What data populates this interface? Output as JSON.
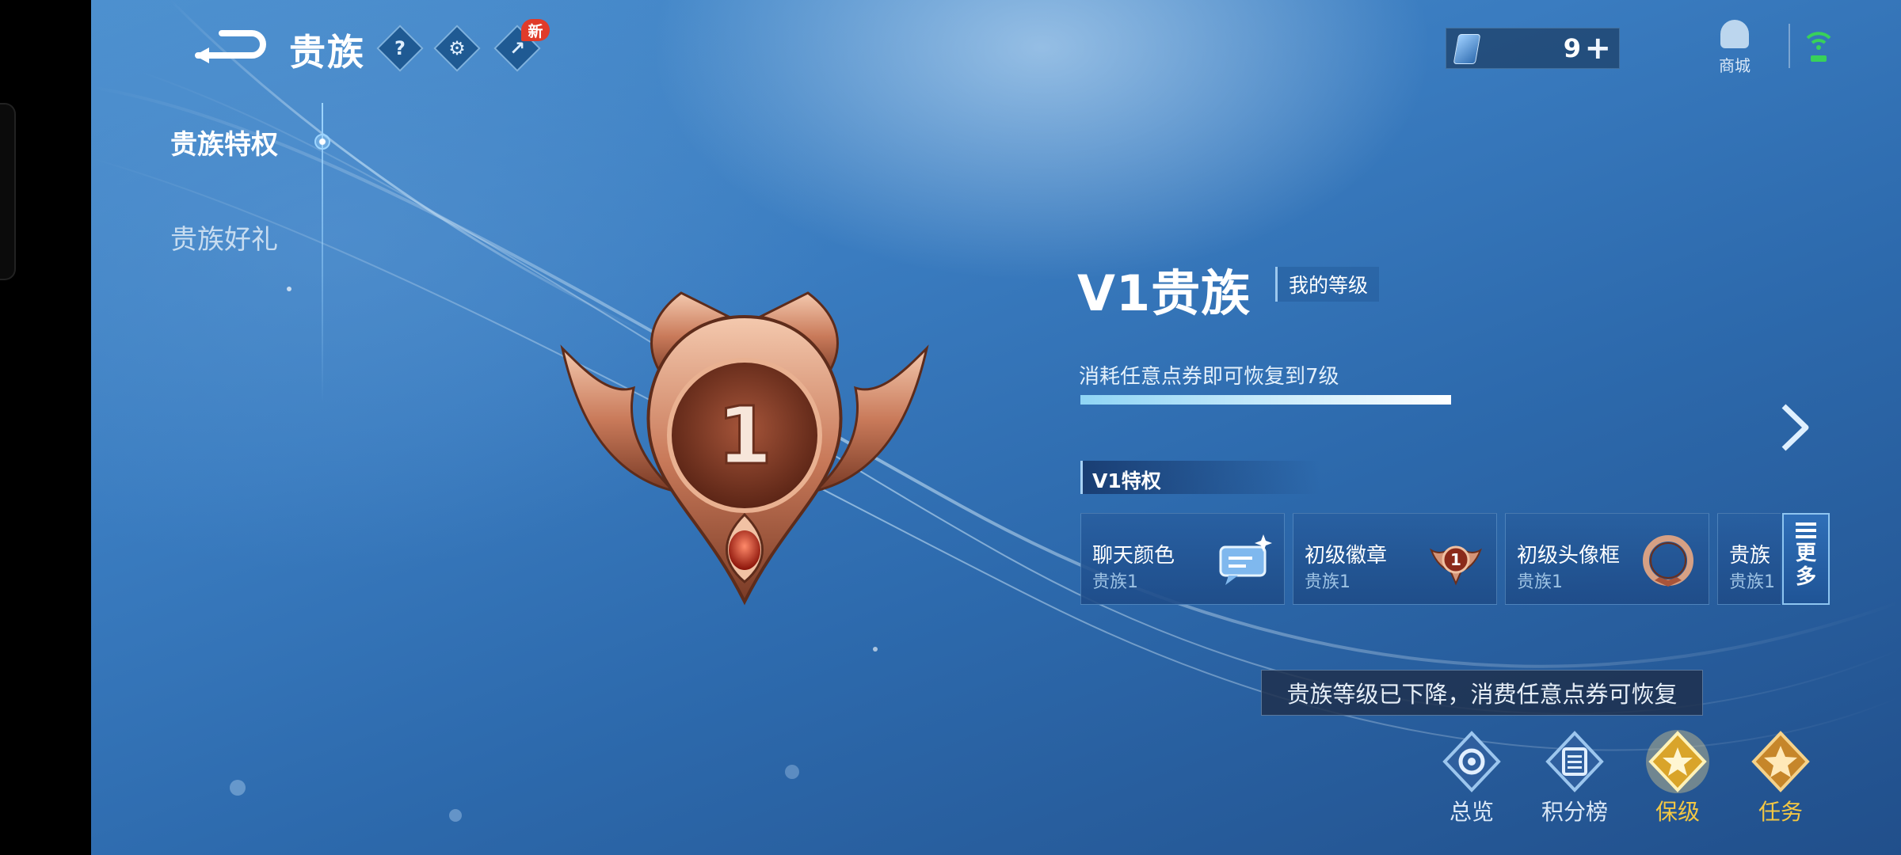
{
  "header": {
    "title": "贵族",
    "help_icon_glyph": "?",
    "new_badge": "新",
    "tickets": {
      "count": "9",
      "plus": "+"
    },
    "shop_label": "商城"
  },
  "sidebar": {
    "items": [
      {
        "label": "贵族特权",
        "active": true
      },
      {
        "label": "贵族好礼",
        "active": false
      }
    ]
  },
  "emblem": {
    "level": "1"
  },
  "panel": {
    "vip_title": "V1贵族",
    "my_level_label": "我的等级",
    "restore_hint": "消耗任意点券即可恢复到7级",
    "progress_fraction": 1.0,
    "privileges_header": "V1特权",
    "privileges": [
      {
        "title": "聊天颜色",
        "sub": "贵族1",
        "icon": "chat-bubble-icon"
      },
      {
        "title": "初级徽章",
        "sub": "贵族1",
        "icon": "badge-icon"
      },
      {
        "title": "初级头像框",
        "sub": "贵族1",
        "icon": "avatar-frame-icon"
      },
      {
        "title": "贵族",
        "sub": "贵族1",
        "icon": "partial-card"
      }
    ],
    "more_label_line1": "更",
    "more_label_line2": "多"
  },
  "toast": "贵族等级已下降，消费任意点券可恢复",
  "bottom_nav": [
    {
      "label": "总览",
      "color": "#dce9f7",
      "icon": "overview-icon"
    },
    {
      "label": "积分榜",
      "color": "#dce9f7",
      "icon": "leaderboard-icon"
    },
    {
      "label": "保级",
      "color": "#f3c743",
      "icon": "shield-star-icon"
    },
    {
      "label": "任务",
      "color": "#f3c743",
      "icon": "task-star-icon"
    }
  ]
}
